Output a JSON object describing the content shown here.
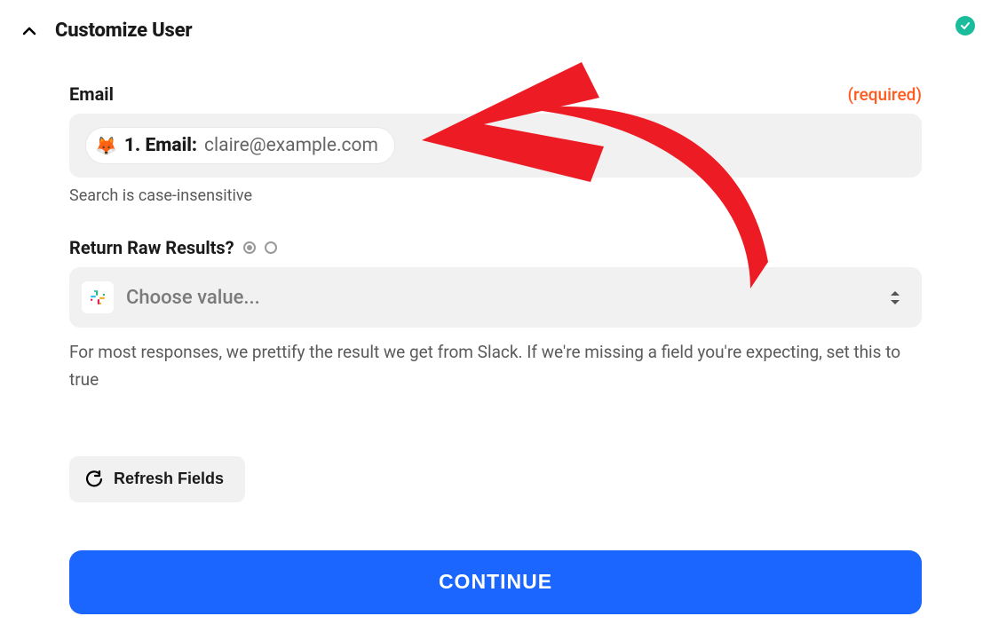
{
  "header": {
    "title": "Customize User"
  },
  "email_field": {
    "label": "Email",
    "required_text": "(required)",
    "chip_label": "1. Email:",
    "chip_value": "claire@example.com",
    "help": "Search is case-insensitive"
  },
  "raw_results": {
    "label": "Return Raw Results?",
    "placeholder": "Choose value...",
    "description": "For most responses, we prettify the result we get from Slack. If we're missing a field you're expecting, set this to true"
  },
  "refresh": {
    "label": "Refresh Fields"
  },
  "continue": {
    "label": "CONTINUE"
  }
}
